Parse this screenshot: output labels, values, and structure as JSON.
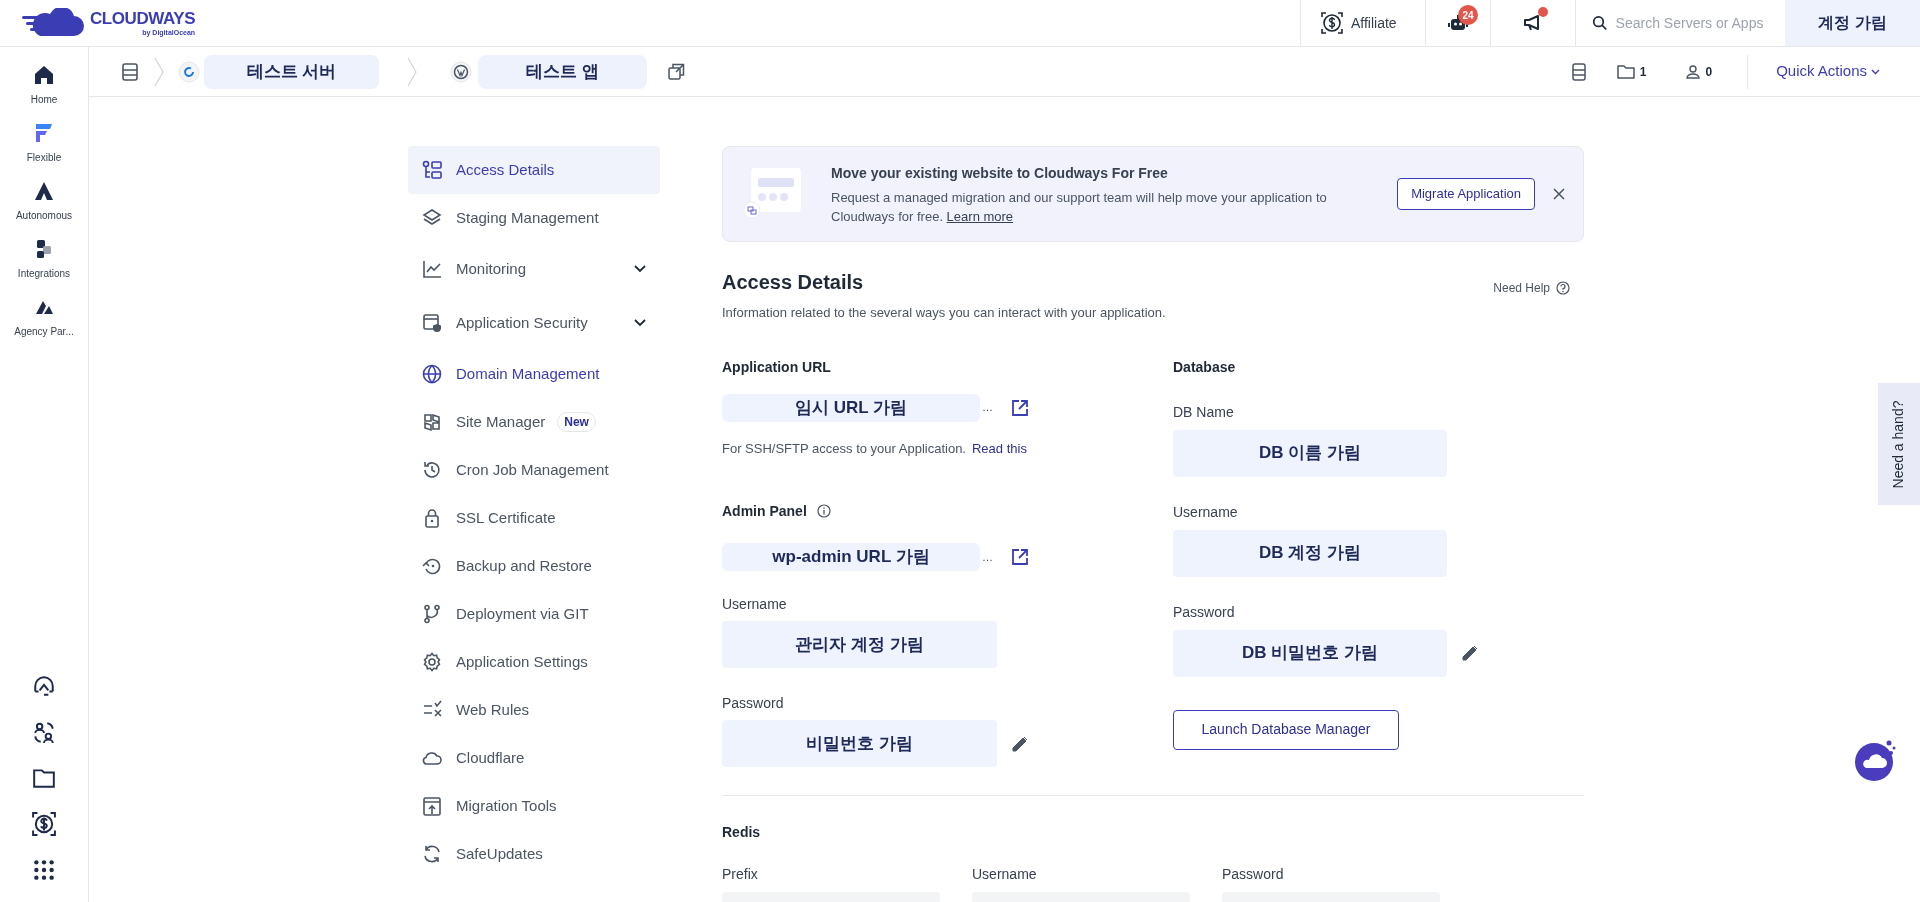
{
  "header": {
    "logo": {
      "name": "CLOUDWAYS",
      "tagline": "by DigitalOcean"
    },
    "affiliate": "Affiliate",
    "bot_badge": "24",
    "announcements_unread": true,
    "search": {
      "placeholder": "Search Servers or Apps"
    },
    "account": "계정 가림"
  },
  "breadcrumb": {
    "server": "테스트 서버",
    "app": "테스트 앱"
  },
  "toolbar": {
    "folders": "1",
    "members": "0",
    "quick_actions": "Quick Actions"
  },
  "sidebar": {
    "items": [
      {
        "label": "Home"
      },
      {
        "label": "Flexible"
      },
      {
        "label": "Autonomous"
      },
      {
        "label": "Integrations"
      },
      {
        "label": "Agency Par..."
      }
    ]
  },
  "nav": [
    {
      "label": "Access Details",
      "kind": "link",
      "selected": true,
      "highlighted": false
    },
    {
      "label": "Staging Management",
      "kind": "link",
      "selected": false,
      "highlighted": false
    },
    {
      "label": "Monitoring",
      "kind": "group",
      "selected": false,
      "highlighted": false
    },
    {
      "label": "Application Security",
      "kind": "group",
      "selected": false,
      "highlighted": false
    },
    {
      "label": "Domain Management",
      "kind": "link",
      "selected": false,
      "highlighted": true
    },
    {
      "label": "Site Manager",
      "kind": "link",
      "selected": false,
      "highlighted": false,
      "badge": "New"
    },
    {
      "label": "Cron Job Management",
      "kind": "link",
      "selected": false,
      "highlighted": false
    },
    {
      "label": "SSL Certificate",
      "kind": "link",
      "selected": false,
      "highlighted": false
    },
    {
      "label": "Backup and Restore",
      "kind": "link",
      "selected": false,
      "highlighted": false
    },
    {
      "label": "Deployment via GIT",
      "kind": "link",
      "selected": false,
      "highlighted": false
    },
    {
      "label": "Application Settings",
      "kind": "link",
      "selected": false,
      "highlighted": false
    },
    {
      "label": "Web Rules",
      "kind": "link",
      "selected": false,
      "highlighted": false
    },
    {
      "label": "Cloudflare",
      "kind": "link",
      "selected": false,
      "highlighted": false
    },
    {
      "label": "Migration Tools",
      "kind": "link",
      "selected": false,
      "highlighted": false
    },
    {
      "label": "SafeUpdates",
      "kind": "link",
      "selected": false,
      "highlighted": false
    }
  ],
  "banner": {
    "title": "Move your existing website to Cloudways For Free",
    "text": "Request a managed migration and our support team will help move your application to Cloudways for free.",
    "link": "Learn more",
    "button": "Migrate Application"
  },
  "access": {
    "heading": "Access Details",
    "description": "Information related to the several ways you can interact with your application.",
    "help": "Need Help",
    "app_url": {
      "label": "Application URL",
      "value": "임시 URL 가림",
      "tail": "…"
    },
    "ssh_note": {
      "text": "For SSH/SFTP access to your Application.",
      "link": "Read this"
    },
    "admin_panel": {
      "label": "Admin Panel",
      "value": "wp-admin URL 가림",
      "tail": "…"
    },
    "admin_fields": [
      {
        "label": "Username",
        "value": "관리자 계정 가림",
        "editable": false
      },
      {
        "label": "Password",
        "value": "비밀번호 가림",
        "editable": true
      }
    ],
    "database": {
      "heading": "Database",
      "fields": [
        {
          "label": "DB Name",
          "value": "DB 이름 가림",
          "editable": false
        },
        {
          "label": "Username",
          "value": "DB 계정 가림",
          "editable": false
        },
        {
          "label": "Password",
          "value": "DB 비밀번호 가림",
          "editable": true
        }
      ],
      "button": "Launch Database Manager"
    },
    "redis": {
      "heading": "Redis",
      "fields": [
        {
          "label": "Prefix"
        },
        {
          "label": "Username"
        },
        {
          "label": "Password"
        }
      ]
    }
  },
  "help_tab": "Need a hand?"
}
